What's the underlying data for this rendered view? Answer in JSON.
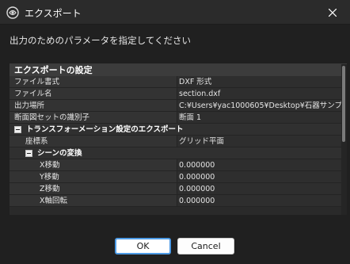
{
  "window": {
    "title": "エクスポート"
  },
  "instruction": "出力のためのパラメータを指定してください",
  "properties": {
    "section_title": "エクスポートの設定",
    "rows": [
      {
        "name": "ファイル書式",
        "value": "DXF 形式"
      },
      {
        "name": "ファイル名",
        "value": "section.dxf"
      },
      {
        "name": "出力場所",
        "value": "C:¥Users¥yac1000605¥Desktop¥石器サンプ..."
      },
      {
        "name": "断面図セットの識別子",
        "value": "断面 1"
      }
    ],
    "transform_group": {
      "label": "トランスフォーメーション設定のエクスポート",
      "coord_row": {
        "name": "座標系",
        "value": "グリッド平面"
      },
      "scene_group": {
        "label": "シーンの変換",
        "rows": [
          {
            "name": "X移動",
            "value": "0.000000"
          },
          {
            "name": "Y移動",
            "value": "0.000000"
          },
          {
            "name": "Z移動",
            "value": "0.000000"
          },
          {
            "name": "X軸回転",
            "value": "0.000000"
          }
        ]
      }
    }
  },
  "buttons": {
    "ok": "OK",
    "cancel": "Cancel"
  },
  "colors": {
    "background": "#202020",
    "titlebar": "#2b2b2b",
    "panel": "#2a2a2a",
    "ok_border": "#4d9be6"
  }
}
